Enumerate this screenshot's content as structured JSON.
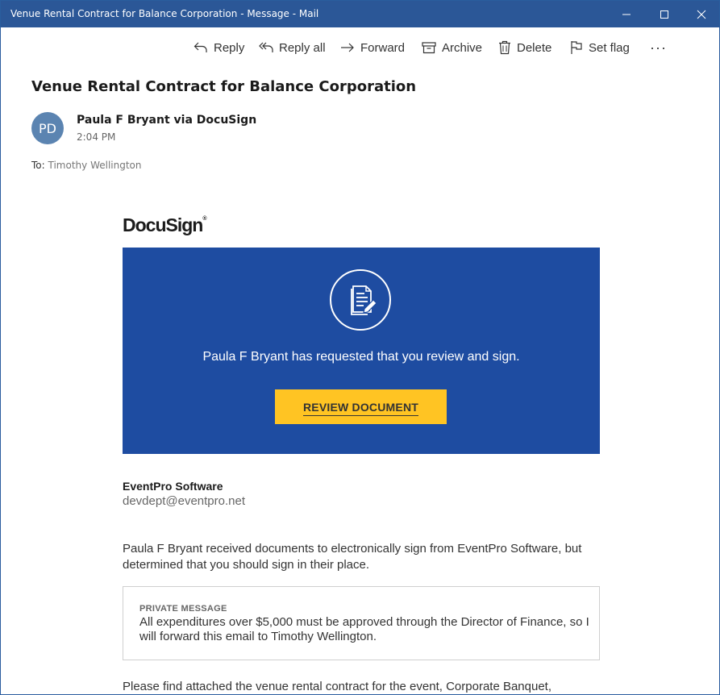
{
  "window": {
    "title": "Venue Rental Contract for Balance Corporation - Message - Mail",
    "title_bar_color": "#2b5797"
  },
  "toolbar": {
    "reply_label": "Reply",
    "reply_all_label": "Reply all",
    "forward_label": "Forward",
    "archive_label": "Archive",
    "delete_label": "Delete",
    "set_flag_label": "Set flag",
    "more_label": "···"
  },
  "message": {
    "subject": "Venue Rental Contract for Balance Corporation",
    "sender_initials": "PD",
    "sender": "Paula F Bryant via DocuSign",
    "time": "2:04 PM",
    "to_label": "To:",
    "to_name": "Timothy Wellington"
  },
  "email_body": {
    "logo_text": "DocuSign",
    "logo_mark": "®",
    "banner_color": "#1e4ca1",
    "banner_text": "Paula F Bryant has requested that you review and sign.",
    "review_button_label": "REVIEW DOCUMENT",
    "review_button_color": "#ffc423",
    "company_name": "EventPro Software",
    "company_email": "devdept@eventpro.net",
    "paragraph1": "Paula F Bryant received documents to electronically sign from EventPro Software, but determined that you should sign in their place.",
    "private_label": "PRIVATE MESSAGE",
    "private_message": "All expenditures over $5,000 must be approved through the Director of Finance, so I will forward this email to Timothy Wellington.",
    "paragraph2": "Please find attached the venue rental contract for the event, Corporate Banquet,"
  }
}
